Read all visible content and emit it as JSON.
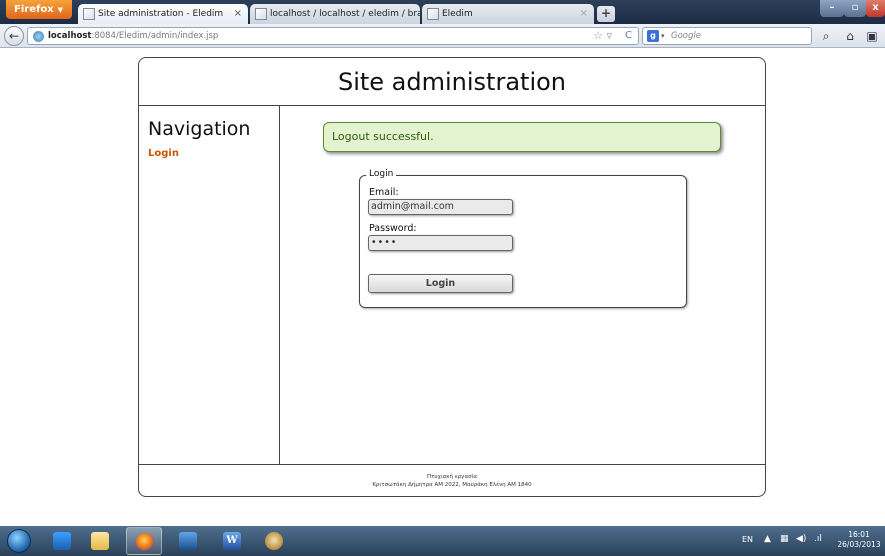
{
  "browser": {
    "firefox_button": "Firefox",
    "tabs": [
      {
        "title": "Site administration - Eledim",
        "close": "×"
      },
      {
        "title": "localhost / localhost / eledim / branc...",
        "close": ""
      },
      {
        "title": "Eledim",
        "close": "×"
      }
    ],
    "new_tab": "+",
    "window_controls": {
      "minimize": "–",
      "maximize": "▫",
      "close": "x"
    },
    "back_icon": "back-arrow-icon",
    "url_host": "localhost",
    "url_path": ":8084/Eledim/admin/index.jsp",
    "search_placeholder": "Google",
    "search_engine_icon": "g"
  },
  "page": {
    "header_title": "Site administration",
    "sidebar": {
      "title": "Navigation",
      "links": [
        "Login"
      ]
    },
    "alert": "Logout successful.",
    "login_form": {
      "legend": "Login",
      "email_label": "Email:",
      "email_value": "admin@mail.com",
      "password_label": "Password:",
      "password_value": "••••",
      "submit_label": "Login"
    },
    "footer": {
      "line1": "Πτυχιακή εργασία",
      "line2": "Κριτσωτάκη Δήμητρα ΑΜ 2022, Μαυράκη Ελένη ΑΜ 1840"
    }
  },
  "taskbar": {
    "apps": [
      "windows-media-player",
      "windows-explorer",
      "firefox",
      "virtualbox",
      "microsoft-word",
      "paint"
    ],
    "tray_language": "EN",
    "clock_time": "16:01",
    "clock_date": "26/03/2013"
  },
  "colors": {
    "accent_link": "#cc5500",
    "alert_background": "#e3f2cf",
    "alert_border": "#5f8a32",
    "alert_text": "#2f5a10"
  }
}
